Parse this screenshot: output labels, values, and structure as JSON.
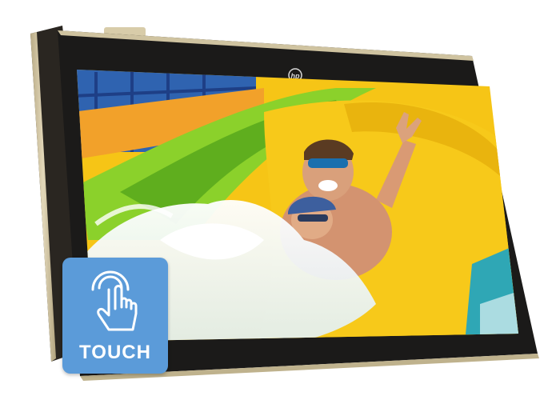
{
  "product": {
    "badge_label": "TOUCH",
    "badge_icon": "touch-hand-icon",
    "logo_icon": "hp-logo-icon",
    "colors": {
      "badge": "#5b9bd9",
      "bezel": "#1a1a1a",
      "chassis": "#c9bd9a",
      "slide_yellow": "#f6c516",
      "slide_green": "#8bd12b"
    }
  }
}
